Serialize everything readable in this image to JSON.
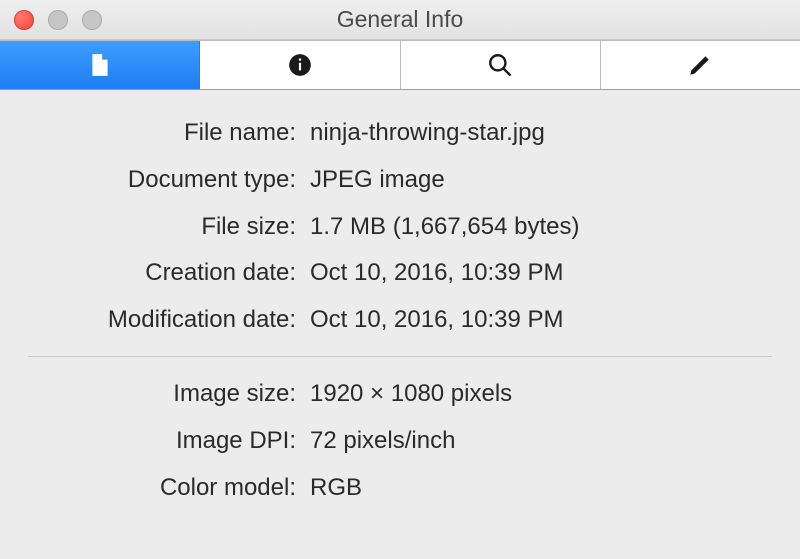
{
  "window": {
    "title": "General Info"
  },
  "tabs": {
    "document": "document",
    "info": "info",
    "search": "search",
    "edit": "edit",
    "active": "document"
  },
  "file": {
    "labels": {
      "file_name": "File name:",
      "doc_type": "Document type:",
      "file_size": "File size:",
      "creation": "Creation date:",
      "modification": "Modification date:"
    },
    "values": {
      "file_name": "ninja-throwing-star.jpg",
      "doc_type": "JPEG image",
      "file_size": "1.7 MB (1,667,654 bytes)",
      "creation": "Oct 10, 2016, 10:39 PM",
      "modification": "Oct 10, 2016, 10:39 PM"
    }
  },
  "image": {
    "labels": {
      "image_size": "Image size:",
      "image_dpi": "Image DPI:",
      "color_model": "Color model:"
    },
    "values": {
      "image_size": "1920 × 1080 pixels",
      "image_dpi": "72 pixels/inch",
      "color_model": "RGB"
    }
  }
}
